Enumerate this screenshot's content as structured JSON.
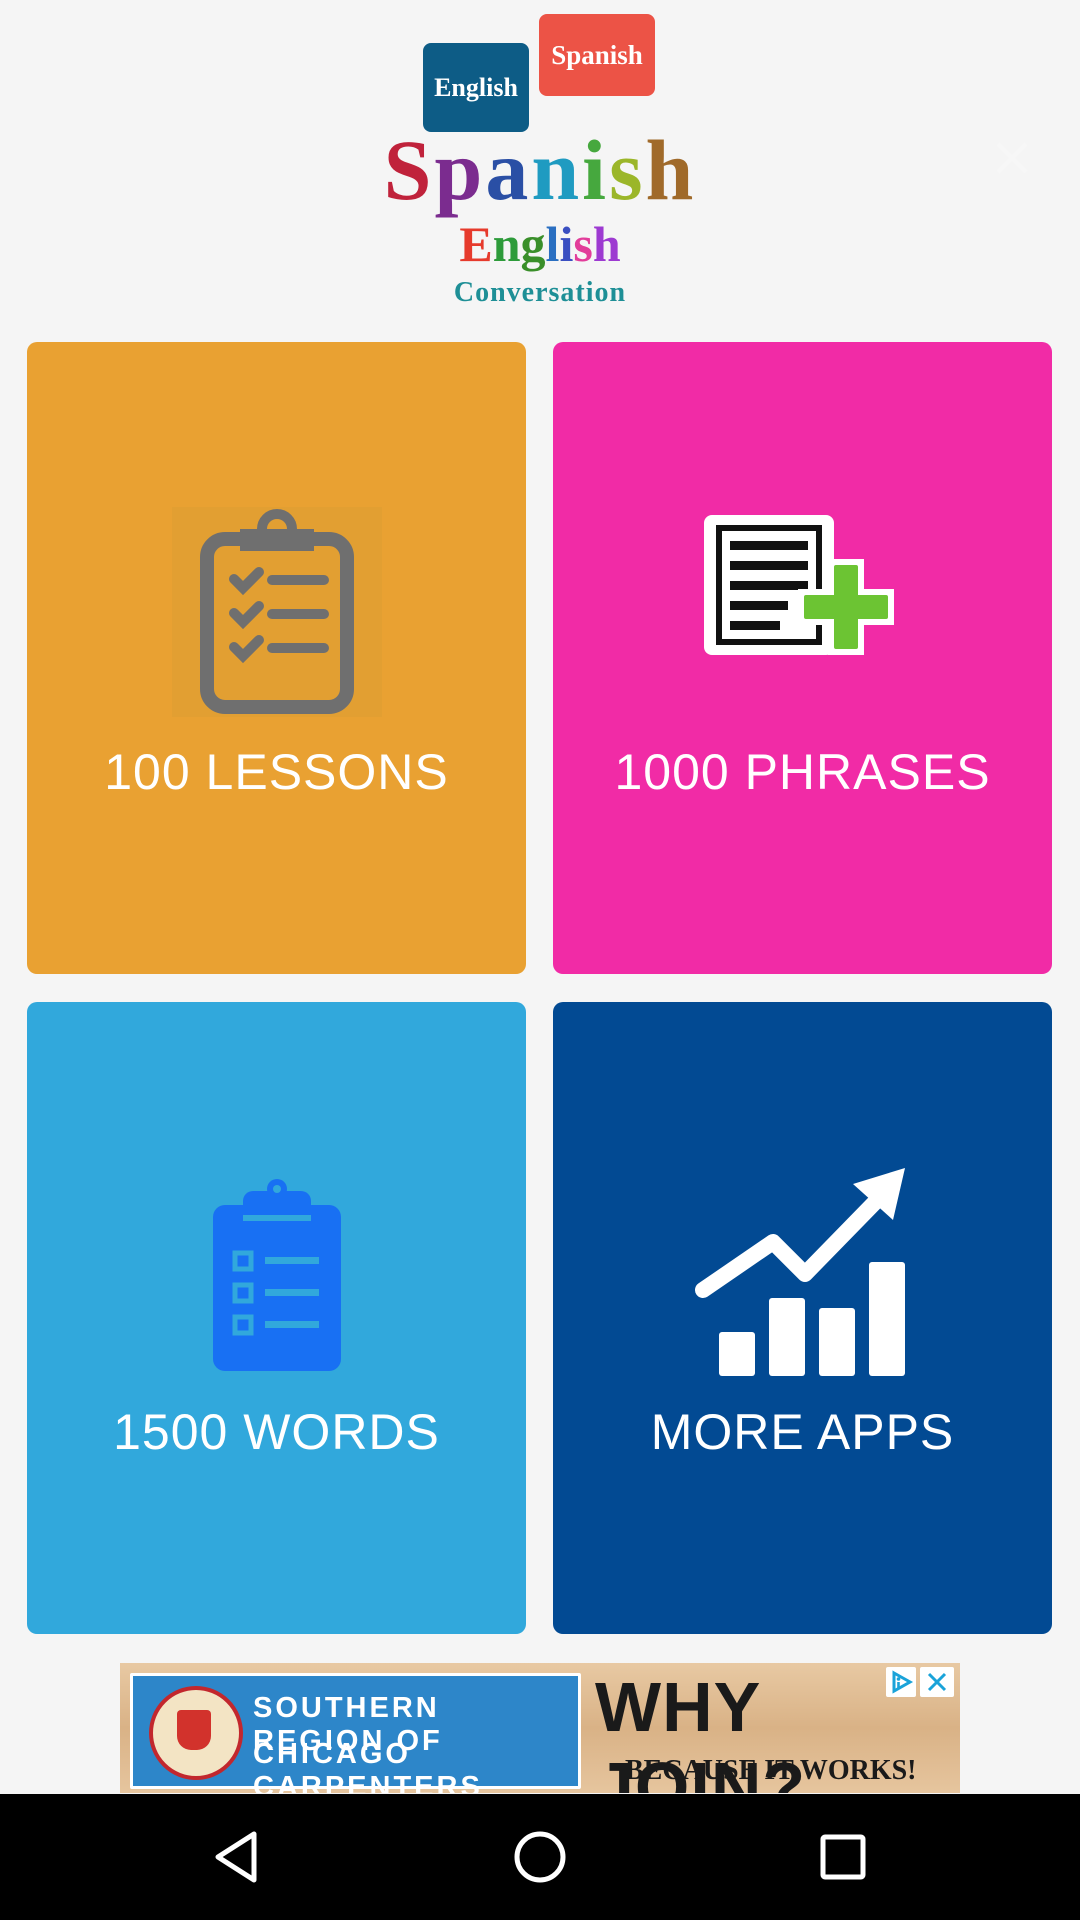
{
  "app_logo": {
    "flag_english": "English",
    "flag_spanish": "Spanish",
    "title_spanish_letters": [
      {
        "ch": "S",
        "color": "#c0223b"
      },
      {
        "ch": "p",
        "color": "#7b2c8f"
      },
      {
        "ch": "a",
        "color": "#2a4fa5"
      },
      {
        "ch": "n",
        "color": "#1f9bc1"
      },
      {
        "ch": "i",
        "color": "#46a83e"
      },
      {
        "ch": "s",
        "color": "#9bb629"
      },
      {
        "ch": "h",
        "color": "#a06a2a"
      }
    ],
    "title_english_letters": [
      {
        "ch": "E",
        "color": "#e63a2c"
      },
      {
        "ch": "n",
        "color": "#2d9b3a"
      },
      {
        "ch": "g",
        "color": "#3a8f2a"
      },
      {
        "ch": "l",
        "color": "#2a6fc1"
      },
      {
        "ch": "i",
        "color": "#3a4fc1"
      },
      {
        "ch": "s",
        "color": "#e23c9a"
      },
      {
        "ch": "h",
        "color": "#9d3ad1"
      }
    ],
    "subtitle": "Conversation"
  },
  "tiles": [
    {
      "label": "100 LESSONS",
      "icon": "clipboard-checklist-icon",
      "color": "#e9a132"
    },
    {
      "label": "1000 PHRASES",
      "icon": "document-add-icon",
      "color": "#f12ba6"
    },
    {
      "label": "1500 WORDS",
      "icon": "clipboard-list-icon",
      "color": "#31a8dc"
    },
    {
      "label": "MORE APPS",
      "icon": "growth-chart-icon",
      "color": "#024a93"
    }
  ],
  "ad": {
    "line1": "SOUTHERN REGION OF",
    "line2": "CHICAGO CARPENTERS",
    "headline": "WHY JOIN?",
    "tagline": "BECAUSE IT WORKS!"
  },
  "navbar": {
    "back": "back-icon",
    "home": "home-icon",
    "recents": "recents-icon"
  }
}
